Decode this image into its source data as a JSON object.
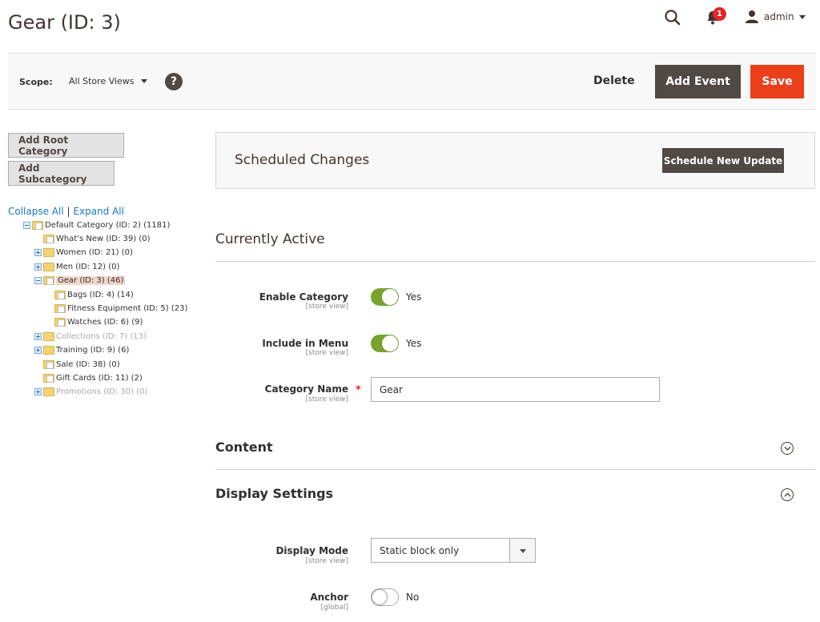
{
  "header": {
    "title": "Gear (ID: 3)",
    "notification_count": "1",
    "user_name": "admin"
  },
  "scope_bar": {
    "scope_label": "Scope:",
    "scope_value": "All Store Views",
    "help_symbol": "?",
    "delete_label": "Delete",
    "add_event_label": "Add Event",
    "save_label": "Save"
  },
  "sidebar": {
    "add_root_label": "Add Root Category",
    "add_sub_label": "Add Subcategory",
    "collapse_all": "Collapse All",
    "separator": "|",
    "expand_all": "Expand All",
    "tree": [
      {
        "label": "Default Category (ID: 2) (1181)",
        "level": 0,
        "expander": "minus",
        "dim": false
      },
      {
        "label": "What's New (ID: 39) (0)",
        "level": 1,
        "expander": "none",
        "dim": false
      },
      {
        "label": "Women (ID: 21) (0)",
        "level": 1,
        "expander": "plus",
        "dim": false
      },
      {
        "label": "Men (ID: 12) (0)",
        "level": 1,
        "expander": "plus",
        "dim": false
      },
      {
        "label": "Gear (ID: 3) (46)",
        "level": 1,
        "expander": "minus",
        "dim": false,
        "selected": true
      },
      {
        "label": "Bags (ID: 4) (14)",
        "level": 2,
        "expander": "none",
        "dim": false
      },
      {
        "label": "Fitness Equipment (ID: 5) (23)",
        "level": 2,
        "expander": "none",
        "dim": false
      },
      {
        "label": "Watches (ID: 6) (9)",
        "level": 2,
        "expander": "none",
        "dim": false
      },
      {
        "label": "Collections (ID: 7) (13)",
        "level": 1,
        "expander": "plus",
        "dim": true
      },
      {
        "label": "Training (ID: 9) (6)",
        "level": 1,
        "expander": "plus",
        "dim": false
      },
      {
        "label": "Sale (ID: 38) (0)",
        "level": 1,
        "expander": "none",
        "dim": false
      },
      {
        "label": "Gift Cards (ID: 11) (2)",
        "level": 1,
        "expander": "none",
        "dim": false
      },
      {
        "label": "Promotions (ID: 30) (0)",
        "level": 1,
        "expander": "plus",
        "dim": true
      }
    ]
  },
  "scheduled": {
    "title": "Scheduled Changes",
    "button_label": "Schedule New Update"
  },
  "main": {
    "currently_active": "Currently Active",
    "enable_category": {
      "label": "Enable Category",
      "scope": "[store view]",
      "value": "Yes",
      "on": true
    },
    "include_in_menu": {
      "label": "Include in Menu",
      "scope": "[store view]",
      "value": "Yes",
      "on": true
    },
    "category_name": {
      "label": "Category Name",
      "scope": "[store view]",
      "value": "Gear",
      "required_mark": "*"
    },
    "content_title": "Content",
    "display_settings_title": "Display Settings",
    "display_mode": {
      "label": "Display Mode",
      "scope": "[store view]",
      "value": "Static block only"
    },
    "anchor": {
      "label": "Anchor",
      "scope": "[global]",
      "value": "No",
      "on": false
    }
  },
  "colors": {
    "accent_dark": "#514943",
    "save_red": "#eb3e1b",
    "toggle_green": "#79a22e",
    "link_blue": "#1979c3"
  }
}
